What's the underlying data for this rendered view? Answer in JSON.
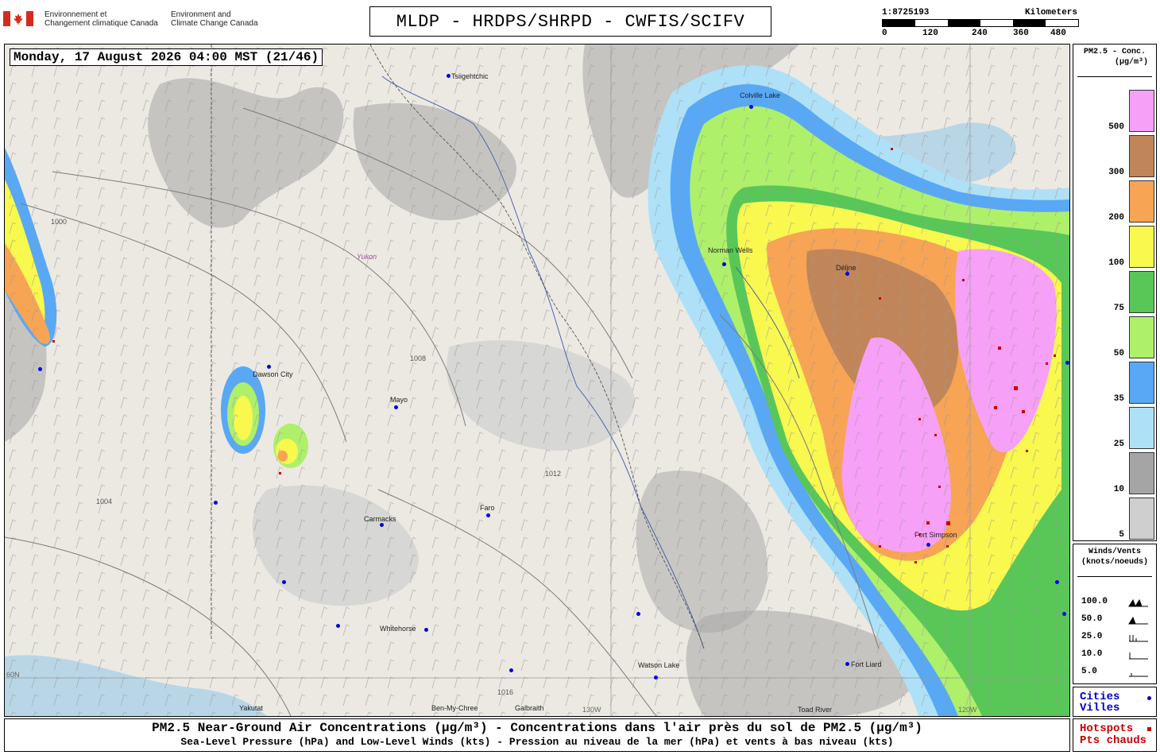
{
  "header": {
    "org_fr_1": "Environnement et",
    "org_fr_2": "Changement climatique Canada",
    "org_en_1": "Environment and",
    "org_en_2": "Climate Change Canada",
    "title": "MLDP - HRDPS/SHRPD - CWFIS/SCIFV"
  },
  "scale_bar": {
    "ratio": "1:8725193",
    "unit": "Kilometers",
    "ticks": [
      "0",
      "120",
      "240",
      "360",
      "480"
    ]
  },
  "map": {
    "timestamp": "Monday, 17 August 2026 04:00 MST (21/46)",
    "region_label": "Yukon",
    "cities": [
      {
        "name": "Tsiigehtchic"
      },
      {
        "name": "Colville Lake"
      },
      {
        "name": "Norman Wells"
      },
      {
        "name": "Délįne"
      },
      {
        "name": "Dawson City"
      },
      {
        "name": "Mayo"
      },
      {
        "name": "Carmacks"
      },
      {
        "name": "Faro"
      },
      {
        "name": "Whitehorse"
      },
      {
        "name": "Watson Lake"
      },
      {
        "name": "Fort Liard"
      },
      {
        "name": "Fort Simpson"
      },
      {
        "name": "Yakutat"
      },
      {
        "name": "Ben-My-Chree"
      },
      {
        "name": "Galbraith"
      },
      {
        "name": "Toad River"
      }
    ],
    "graticule_labels": [
      "60N",
      "130W",
      "120W"
    ],
    "isobar_values": [
      "1000",
      "1004",
      "1008",
      "1012",
      "1016"
    ]
  },
  "pm_legend": {
    "title_1": "PM2.5 - Conc.",
    "title_2": "(µg/m³)",
    "levels": [
      {
        "label": "500",
        "color": "#f7a0f7"
      },
      {
        "label": "300",
        "color": "#c0865a"
      },
      {
        "label": "200",
        "color": "#f7a455"
      },
      {
        "label": "100",
        "color": "#f8f84f"
      },
      {
        "label": "75",
        "color": "#58c758"
      },
      {
        "label": "50",
        "color": "#aef06a"
      },
      {
        "label": "35",
        "color": "#58a8f6"
      },
      {
        "label": "25",
        "color": "#aee1f7"
      },
      {
        "label": "10",
        "color": "#a5a5a5"
      },
      {
        "label": "5",
        "color": "#cfcfcf"
      }
    ]
  },
  "wind_legend": {
    "title_1": "Winds/Vents",
    "title_2": "(knots/noeuds)",
    "rows": [
      "100.0",
      "50.0",
      "25.0",
      "10.0",
      "5.0"
    ]
  },
  "cities_legend": {
    "line1": "Cities",
    "line2": "Villes"
  },
  "hotspots_legend": {
    "line1": "Hotspots",
    "line2": "Pts chauds"
  },
  "caption": {
    "line1": "PM2.5 Near-Ground Air Concentrations (µg/m³) - Concentrations dans l'air près du sol de PM2.5 (µg/m³)",
    "line2": "Sea-Level Pressure (hPa) and Low-Level Winds (kts) - Pression au niveau de la mer (hPa) et vents à bas niveau (kts)"
  }
}
